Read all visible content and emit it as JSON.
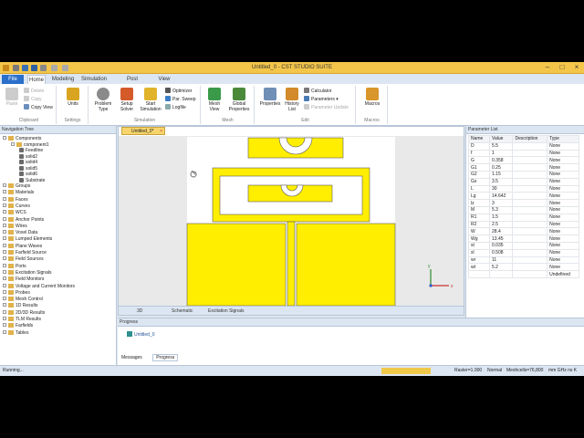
{
  "window": {
    "title": "Untitled_0 - CST STUDIO SUITE"
  },
  "ribbon": {
    "tabs": [
      {
        "label": "File"
      },
      {
        "label": "Home"
      },
      {
        "label": "Modeling"
      },
      {
        "label": "Simulation"
      },
      {
        "label": "Post Processing"
      },
      {
        "label": "View"
      }
    ],
    "clipboard": {
      "paste": "Paste",
      "delete": "Delete",
      "copy": "Copy",
      "copy_view": "Copy View",
      "label": "Clipboard"
    },
    "settings": {
      "units": "Units",
      "label": "Settings"
    },
    "simulation": {
      "problem_type": "Problem Type",
      "setup_solver": "Setup Solver",
      "start_simulation": "Start Simulation",
      "optimizer": "Optimizer",
      "par_sweep": "Par. Sweep",
      "logfile": "Logfile",
      "label": "Simulation"
    },
    "mesh": {
      "mesh_view": "Mesh View",
      "global_properties": "Global Properties",
      "label": "Mesh"
    },
    "edit": {
      "properties": "Properties",
      "history_list": "History List",
      "calculator": "Calculator",
      "parameters": "Parameters",
      "parameter_update": "Parameter Update",
      "label": "Edit"
    },
    "macros": {
      "macros": "Macros",
      "label": "Macros"
    }
  },
  "nav": {
    "title": "Navigation Tree",
    "items": [
      "Components",
      "component1",
      "Feedline",
      "solid2",
      "solid4",
      "solid5",
      "solid6",
      "Substrate",
      "Groups",
      "Materials",
      "Faces",
      "Curves",
      "WCS",
      "Anchor Points",
      "Wires",
      "Voxel Data",
      "Lumped Elements",
      "Plane Waves",
      "Farfield Source",
      "Field Sources",
      "Ports",
      "Excitation Signals",
      "Field Monitors",
      "Voltage and Current Monitors",
      "Probes",
      "Mesh Control",
      "1D Results",
      "2D/3D Results",
      "TLM Results",
      "Farfields",
      "Tables"
    ]
  },
  "viewer": {
    "doc_tab": "Untitled_0*",
    "tabs": [
      "3D",
      "Schematic",
      "Excitation Signals"
    ],
    "axis_x": "x",
    "axis_y": "y"
  },
  "params": {
    "title": "Parameter List",
    "headers": [
      "Name",
      "Value",
      "Description",
      "Type"
    ],
    "rows": [
      [
        "D",
        "5.5",
        "",
        "None"
      ],
      [
        "f",
        "1",
        "",
        "None"
      ],
      [
        "G",
        "0.358",
        "",
        "None"
      ],
      [
        "G1",
        "0.25",
        "",
        "None"
      ],
      [
        "G2",
        "1.15",
        "",
        "None"
      ],
      [
        "Gx",
        "3.5",
        "",
        "None"
      ],
      [
        "L",
        "30",
        "",
        "None"
      ],
      [
        "Lg",
        "14.642",
        "",
        "None"
      ],
      [
        "lz",
        "3",
        "",
        "None"
      ],
      [
        "M",
        "5.3",
        "",
        "None"
      ],
      [
        "R1",
        "1.5",
        "",
        "None"
      ],
      [
        "R2",
        "2.5",
        "",
        "None"
      ],
      [
        "W",
        "28.4",
        "",
        "None"
      ],
      [
        "Wg",
        "13.45",
        "",
        "None"
      ],
      [
        "st",
        "0.035",
        "",
        "None"
      ],
      [
        "sl",
        "0.508",
        "",
        "None"
      ],
      [
        "wr",
        "11",
        "",
        "None"
      ],
      [
        "wt",
        "5.2",
        "",
        "None"
      ],
      [
        "",
        "",
        "",
        "Undefined"
      ]
    ]
  },
  "progress": {
    "title": "Progress",
    "item": "Untitled_0",
    "tabs": [
      "Messages",
      "Progress"
    ]
  },
  "status": {
    "left": "Running...",
    "raster": "Raster=1.000",
    "normal": "Normal",
    "mesh": "Meshcells=76,800",
    "units": "mm GHz ns K"
  },
  "colors": {
    "title_bar": "#f3c64a",
    "patch": "#ffee00",
    "file_tab": "#2a6fc9"
  }
}
